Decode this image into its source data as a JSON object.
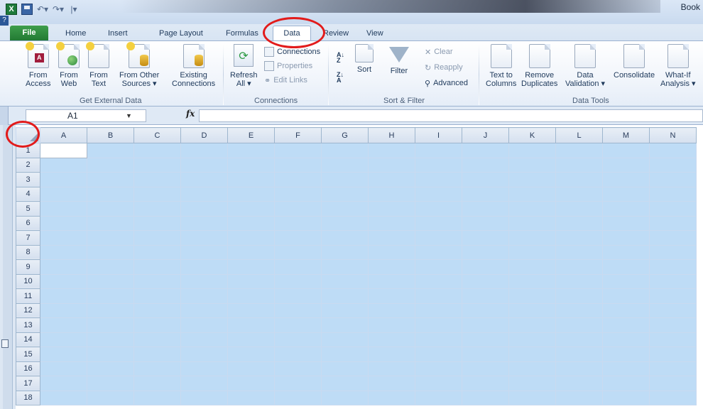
{
  "window": {
    "title": "Book"
  },
  "tabs": [
    "File",
    "Home",
    "Insert",
    "Page Layout",
    "Formulas",
    "Data",
    "Review",
    "View"
  ],
  "ribbon": {
    "get_external_data": {
      "label": "Get External Data",
      "buttons": [
        {
          "line1": "From",
          "line2": "Access"
        },
        {
          "line1": "From",
          "line2": "Web"
        },
        {
          "line1": "From",
          "line2": "Text"
        },
        {
          "line1": "From Other",
          "line2": "Sources ▾"
        },
        {
          "line1": "Existing",
          "line2": "Connections"
        }
      ]
    },
    "connections": {
      "label": "Connections",
      "refresh": {
        "line1": "Refresh",
        "line2": "All ▾"
      },
      "items": [
        "Connections",
        "Properties",
        "Edit Links"
      ]
    },
    "sort_filter": {
      "label": "Sort & Filter",
      "sort": "Sort",
      "filter": "Filter",
      "items": [
        "Clear",
        "Reapply",
        "Advanced"
      ]
    },
    "data_tools": {
      "label": "Data Tools",
      "buttons": [
        {
          "line1": "Text to",
          "line2": "Columns"
        },
        {
          "line1": "Remove",
          "line2": "Duplicates"
        },
        {
          "line1": "Data",
          "line2": "Validation ▾"
        },
        {
          "line1": "Consolidate",
          "line2": ""
        },
        {
          "line1": "What-If",
          "line2": "Analysis ▾"
        }
      ]
    }
  },
  "formula_bar": {
    "name_box": "A1",
    "fx": "fx",
    "value": ""
  },
  "grid": {
    "columns": [
      "A",
      "B",
      "C",
      "D",
      "E",
      "F",
      "G",
      "H",
      "I",
      "J",
      "K",
      "L",
      "M",
      "N"
    ],
    "rows": [
      "1",
      "2",
      "3",
      "4",
      "5",
      "6",
      "7",
      "8",
      "9",
      "10",
      "11",
      "12",
      "13",
      "14",
      "15",
      "16",
      "17",
      "18"
    ],
    "active_cell": "A1"
  },
  "colors": {
    "selection": "#bedcf6",
    "annotation": "#e21b1b",
    "file_tab": "#227a33"
  }
}
